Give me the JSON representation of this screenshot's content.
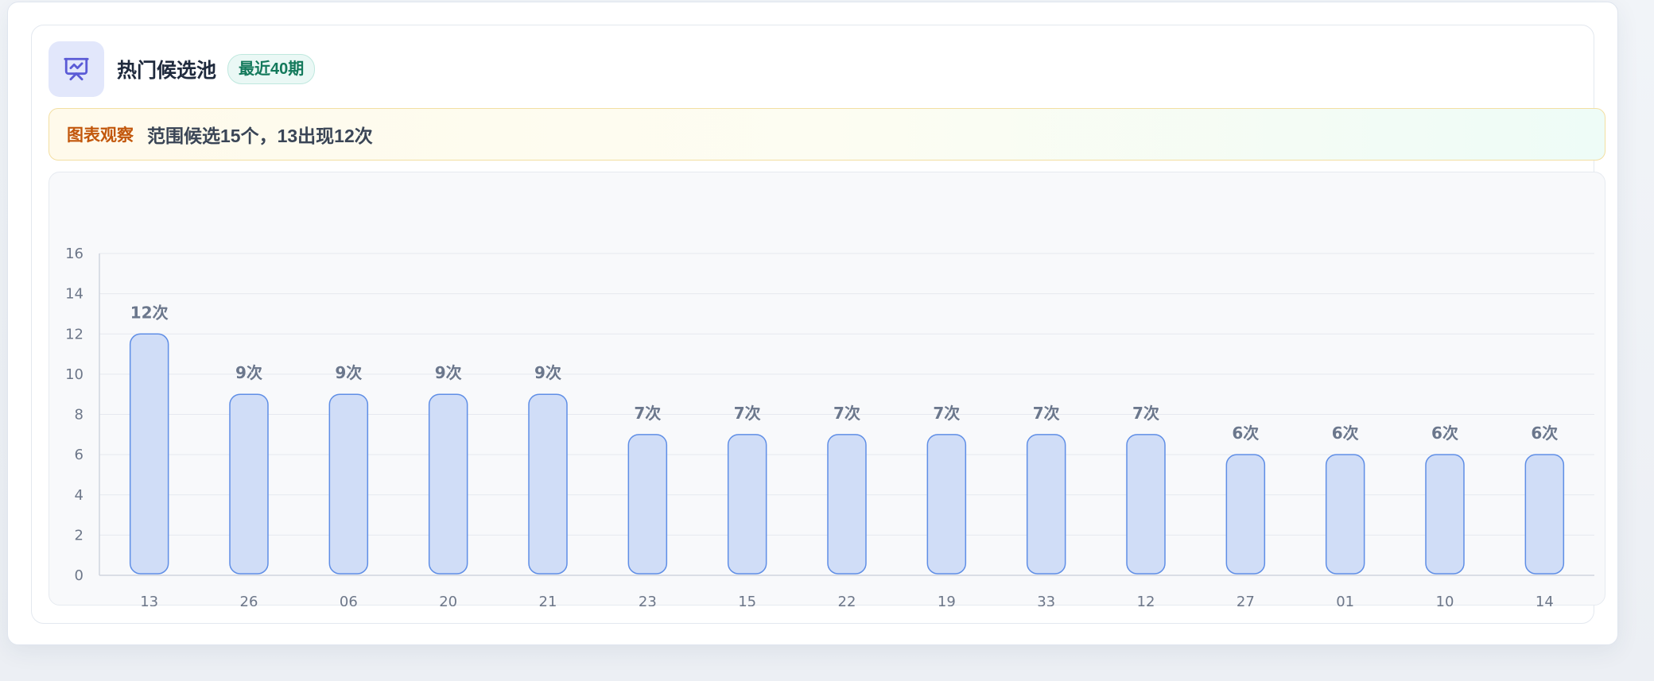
{
  "header": {
    "title": "热门候选池",
    "badge": "最近40期",
    "icon": "presentation-chart-icon"
  },
  "observation": {
    "label": "图表观察",
    "text": "范围候选15个，13出现12次"
  },
  "colors": {
    "accent": "#5b5bd6",
    "bar_fill": "#d0ddf7",
    "bar_stroke": "#5f8ee6",
    "badge_text": "#13795b",
    "obs_label": "#c2570c"
  },
  "chart_data": {
    "type": "bar",
    "categories": [
      "13",
      "26",
      "06",
      "20",
      "21",
      "23",
      "15",
      "22",
      "19",
      "33",
      "12",
      "27",
      "01",
      "10",
      "14"
    ],
    "values": [
      12,
      9,
      9,
      9,
      9,
      7,
      7,
      7,
      7,
      7,
      7,
      6,
      6,
      6,
      6
    ],
    "value_labels": [
      "12次",
      "9次",
      "9次",
      "9次",
      "9次",
      "7次",
      "7次",
      "7次",
      "7次",
      "7次",
      "7次",
      "6次",
      "6次",
      "6次",
      "6次"
    ],
    "ylim": [
      0,
      16
    ],
    "yticks": [
      0,
      2,
      4,
      6,
      8,
      10,
      12,
      14,
      16
    ],
    "grid": true,
    "title": "",
    "xlabel": "",
    "ylabel": ""
  }
}
